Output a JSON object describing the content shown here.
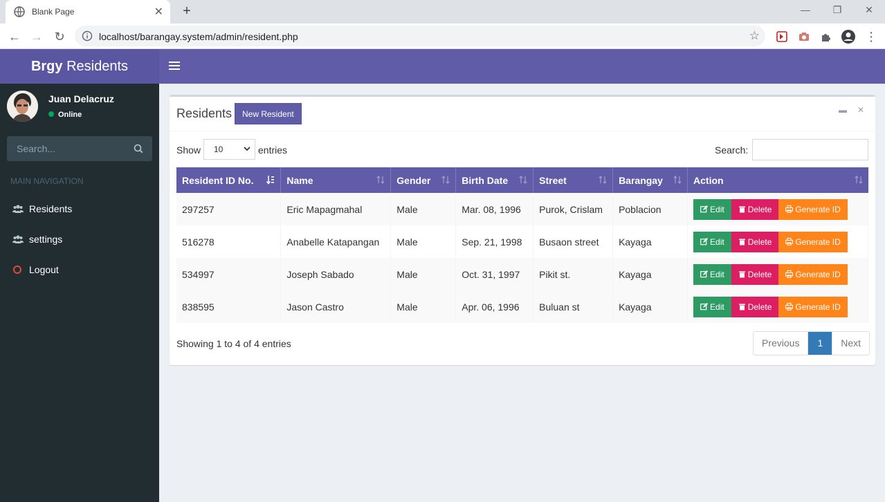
{
  "browser": {
    "tab_title": "Blank Page",
    "url": "localhost/barangay.system/admin/resident.php"
  },
  "app": {
    "brand_bold": "Brgy",
    "brand_rest": "Residents"
  },
  "user": {
    "name": "Juan Delacruz",
    "status": "Online"
  },
  "sidebar": {
    "search_placeholder": "Search...",
    "header": "MAIN NAVIGATION",
    "items": [
      {
        "label": "Residents",
        "icon": "users-icon"
      },
      {
        "label": "settings",
        "icon": "users-icon"
      },
      {
        "label": "Logout",
        "icon": "circle-icon"
      }
    ]
  },
  "box": {
    "title": "Residents",
    "new_button": "New Resident",
    "show_label": "Show",
    "entries_value": "10",
    "entries_label": "entries",
    "search_label": "Search:",
    "search_value": ""
  },
  "table": {
    "columns": [
      "Resident ID No.",
      "Name",
      "Gender",
      "Birth Date",
      "Street",
      "Barangay",
      "Action"
    ],
    "rows": [
      {
        "id": "297257",
        "name": "Eric Mapagmahal",
        "gender": "Male",
        "birth": "Mar. 08, 1996",
        "street": "Purok, Crislam",
        "barangay": "Poblacion"
      },
      {
        "id": "516278",
        "name": "Anabelle Katapangan",
        "gender": "Male",
        "birth": "Sep. 21, 1998",
        "street": "Busaon street",
        "barangay": "Kayaga"
      },
      {
        "id": "534997",
        "name": "Joseph Sabado",
        "gender": "Male",
        "birth": "Oct. 31, 1997",
        "street": "Pikit st.",
        "barangay": "Kayaga"
      },
      {
        "id": "838595",
        "name": "Jason Castro",
        "gender": "Male",
        "birth": "Apr. 06, 1996",
        "street": "Buluan st",
        "barangay": "Kayaga"
      }
    ],
    "actions": {
      "edit": "Edit",
      "delete": "Delete",
      "generate": "Generate ID"
    }
  },
  "footer": {
    "info": "Showing 1 to 4 of 4 entries",
    "prev": "Previous",
    "page": "1",
    "next": "Next"
  },
  "colors": {
    "header": "#605ca8",
    "sidebar": "#222d32",
    "edit": "#2e9b64",
    "delete": "#dd1e62",
    "generate": "#ff851b"
  }
}
